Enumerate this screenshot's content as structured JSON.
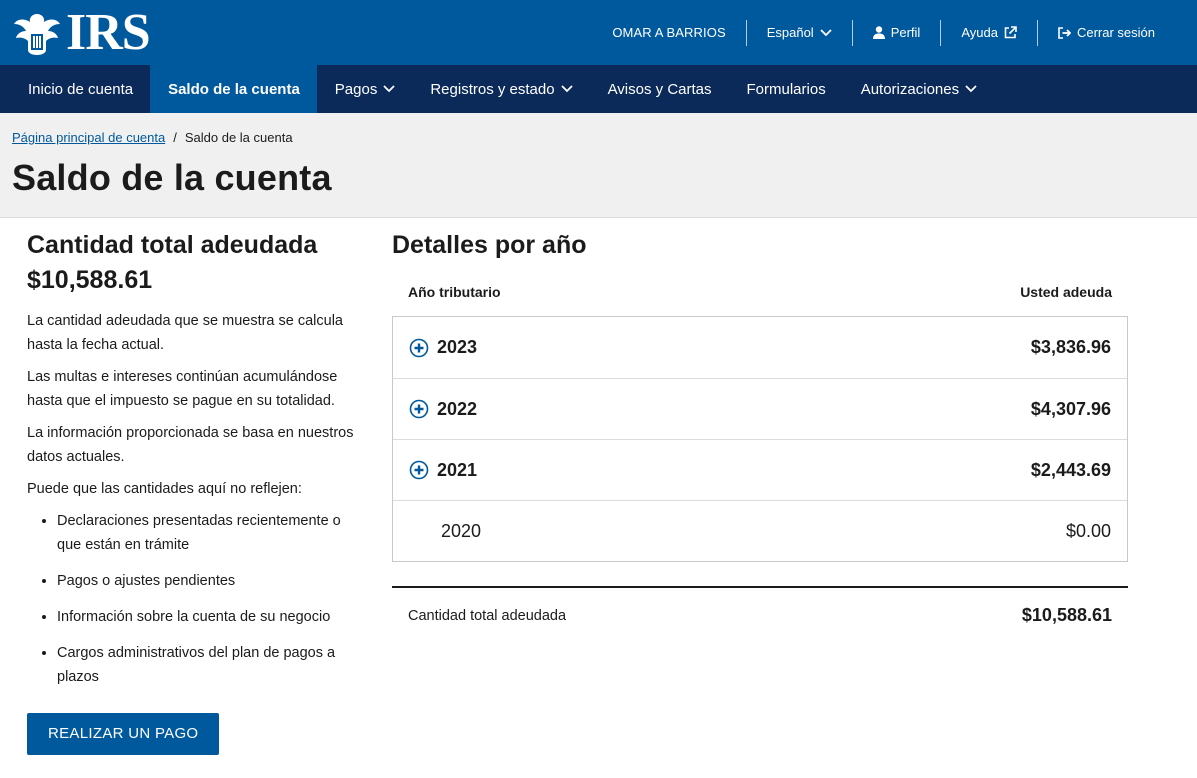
{
  "header": {
    "logo_text": "IRS",
    "user_name": "OMAR A BARRIOS",
    "language": "Español",
    "profile": "Perfil",
    "help": "Ayuda",
    "logout": "Cerrar sesión"
  },
  "nav": {
    "items": [
      {
        "label": "Inicio de cuenta"
      },
      {
        "label": "Saldo de la cuenta"
      },
      {
        "label": "Pagos"
      },
      {
        "label": "Registros y estado"
      },
      {
        "label": "Avisos y Cartas"
      },
      {
        "label": "Formularios"
      },
      {
        "label": "Autorizaciones"
      }
    ],
    "active": "Saldo de la cuenta"
  },
  "breadcrumb": {
    "home": "Página principal de cuenta",
    "separator": "/",
    "current": "Saldo de la cuenta"
  },
  "page_title": "Saldo de la cuenta",
  "summary": {
    "heading": "Cantidad total adeudada",
    "amount": "$10,588.61",
    "paragraphs": [
      "La cantidad adeudada que se muestra se calcula hasta la fecha actual.",
      "Las multas e intereses continúan acumulándose hasta que el impuesto se pague en su totalidad.",
      "La información proporcionada se basa en nuestros datos actuales.",
      "Puede que las cantidades aquí no reflejen:"
    ],
    "bullets": [
      "Declaraciones presentadas recientemente o que están en trámite",
      "Pagos o ajustes pendientes",
      "Información sobre la cuenta de su negocio",
      "Cargos administrativos del plan de pagos a plazos"
    ],
    "pay_button": "REALIZAR UN PAGO"
  },
  "details": {
    "heading": "Detalles por año",
    "col_year": "Año tributario",
    "col_owed": "Usted adeuda",
    "rows": [
      {
        "year": "2023",
        "amount": "$3,836.96"
      },
      {
        "year": "2022",
        "amount": "$4,307.96"
      },
      {
        "year": "2021",
        "amount": "$2,443.69"
      },
      {
        "year": "2020",
        "amount": "$0.00"
      }
    ],
    "total_label": "Cantidad total adeudada",
    "total_amount": "$10,588.61"
  },
  "colors": {
    "header_blue": "#00599c",
    "nav_navy": "#0b2a5a"
  }
}
